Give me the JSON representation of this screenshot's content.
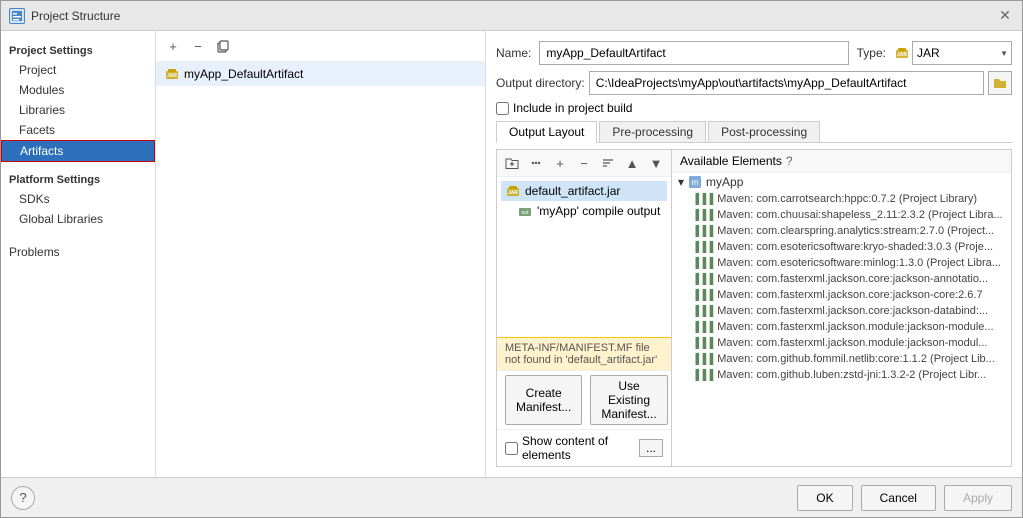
{
  "window": {
    "title": "Project Structure",
    "icon": "P"
  },
  "sidebar": {
    "project_settings_label": "Project Settings",
    "items": [
      {
        "id": "project",
        "label": "Project"
      },
      {
        "id": "modules",
        "label": "Modules"
      },
      {
        "id": "libraries",
        "label": "Libraries"
      },
      {
        "id": "facets",
        "label": "Facets"
      },
      {
        "id": "artifacts",
        "label": "Artifacts",
        "active": true
      }
    ],
    "platform_settings_label": "Platform Settings",
    "platform_items": [
      {
        "id": "sdks",
        "label": "SDKs"
      },
      {
        "id": "global-libraries",
        "label": "Global Libraries"
      }
    ],
    "problems_label": "Problems"
  },
  "artifact": {
    "name": "myApp_DefaultArtifact",
    "type_label": "Type:",
    "type_value": "JAR",
    "name_label": "Name:",
    "output_dir_label": "Output directory:",
    "output_dir_value": "C:\\IdeaProjects\\myApp\\out\\artifacts\\myApp_DefaultArtifact",
    "include_in_build_label": "Include in project build"
  },
  "tabs": [
    {
      "id": "output-layout",
      "label": "Output Layout",
      "active": true
    },
    {
      "id": "pre-processing",
      "label": "Pre-processing"
    },
    {
      "id": "post-processing",
      "label": "Post-processing"
    }
  ],
  "tree": {
    "items": [
      {
        "id": "jar",
        "label": "default_artifact.jar",
        "indent": 0
      },
      {
        "id": "compile",
        "label": "'myApp' compile output",
        "indent": 1
      }
    ]
  },
  "warning": {
    "text": "META-INF/MANIFEST.MF file not found in 'default_artifact.jar'"
  },
  "manifest_buttons": {
    "create": "Create Manifest...",
    "use_existing": "Use Existing Manifest..."
  },
  "show_content": {
    "label": "Show content of elements",
    "dots_label": "..."
  },
  "available_elements": {
    "header": "Available Elements",
    "group": "myApp",
    "items": [
      "Maven: com.carrotsearch:hppc:0.7.2 (Project Library)",
      "Maven: com.chuusai:shapeless_2.11:2.3.2 (Project Libra...",
      "Maven: com.clearspring.analytics:stream:2.7.0 (Project...",
      "Maven: com.esotericsoftware:kryo-shaded:3.0.3 (Proje...",
      "Maven: com.esotericsoftware:minlog:1.3.0 (Project Libra...",
      "Maven: com.fasterxml.jackson.core:jackson-annotatio...",
      "Maven: com.fasterxml.jackson.core:jackson-core:2.6.7",
      "Maven: com.fasterxml.jackson.core:jackson-databind:...",
      "Maven: com.fasterxml.jackson.module:jackson-module...",
      "Maven: com.fasterxml.jackson.module:jackson-modul...",
      "Maven: com.github.fommil.netlib:core:1.1.2 (Project Lib...",
      "Maven: com.github.luben:zstd-jni:1.3.2-2 (Project Libr..."
    ]
  },
  "bottom_buttons": {
    "help": "?",
    "ok": "OK",
    "cancel": "Cancel",
    "apply": "Apply"
  }
}
